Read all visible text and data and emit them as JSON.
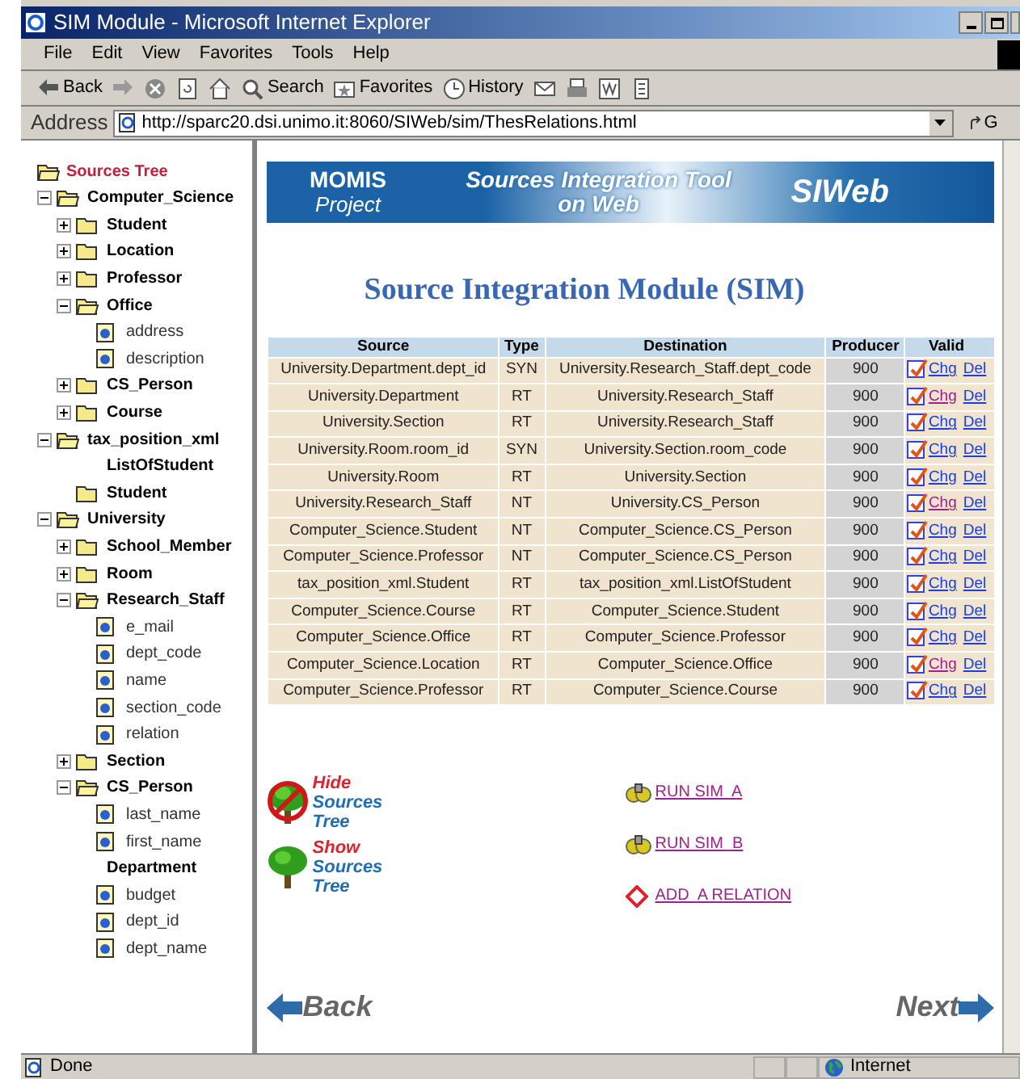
{
  "window": {
    "title": "SIM Module - Microsoft Internet Explorer"
  },
  "menu": [
    "File",
    "Edit",
    "View",
    "Favorites",
    "Tools",
    "Help"
  ],
  "toolbar": [
    {
      "kind": "back",
      "label": "Back"
    },
    {
      "kind": "forward"
    },
    {
      "kind": "stop"
    },
    {
      "kind": "refresh"
    },
    {
      "kind": "home"
    },
    {
      "kind": "search",
      "label": "Search"
    },
    {
      "kind": "favorites",
      "label": "Favorites"
    },
    {
      "kind": "history",
      "label": "History"
    },
    {
      "kind": "mail"
    },
    {
      "kind": "print"
    },
    {
      "kind": "edit"
    },
    {
      "kind": "discuss"
    }
  ],
  "address": {
    "label": "Address",
    "url": "http://sparc20.dsi.unimo.it:8060/SIWeb/sim/ThesRelations.html",
    "go": "G"
  },
  "tree": {
    "title": "Sources Tree",
    "nodes": [
      {
        "label": "Computer_Science",
        "kind": "folder",
        "expanded": true,
        "children": [
          {
            "label": "Student",
            "kind": "folder",
            "expanded": false
          },
          {
            "label": "Location",
            "kind": "folder",
            "expanded": false
          },
          {
            "label": "Professor",
            "kind": "folder",
            "expanded": false
          },
          {
            "label": "Office",
            "kind": "folder",
            "expanded": true,
            "children": [
              {
                "label": "address",
                "kind": "field"
              },
              {
                "label": "description",
                "kind": "field"
              }
            ]
          },
          {
            "label": "CS_Person",
            "kind": "folder",
            "expanded": false
          },
          {
            "label": "Course",
            "kind": "folder",
            "expanded": false
          }
        ]
      },
      {
        "label": "tax_position_xml",
        "kind": "folder",
        "expanded": true,
        "children": [
          {
            "label": "ListOfStudent",
            "kind": "label"
          },
          {
            "label": "Student",
            "kind": "folder"
          }
        ]
      },
      {
        "label": "University",
        "kind": "folder",
        "expanded": true,
        "children": [
          {
            "label": "School_Member",
            "kind": "folder",
            "expanded": false
          },
          {
            "label": "Room",
            "kind": "folder",
            "expanded": false
          },
          {
            "label": "Research_Staff",
            "kind": "folder",
            "expanded": true,
            "children": [
              {
                "label": "e_mail",
                "kind": "field"
              },
              {
                "label": "dept_code",
                "kind": "field"
              },
              {
                "label": "name",
                "kind": "field"
              },
              {
                "label": "section_code",
                "kind": "field"
              },
              {
                "label": "relation",
                "kind": "field"
              }
            ]
          },
          {
            "label": "Section",
            "kind": "folder",
            "expanded": false
          },
          {
            "label": "CS_Person",
            "kind": "folder",
            "expanded": true,
            "children": [
              {
                "label": "last_name",
                "kind": "field"
              },
              {
                "label": "first_name",
                "kind": "field"
              }
            ]
          },
          {
            "label": "Department",
            "kind": "label",
            "children": [
              {
                "label": "budget",
                "kind": "field"
              },
              {
                "label": "dept_id",
                "kind": "field"
              },
              {
                "label": "dept_name",
                "kind": "field"
              }
            ]
          }
        ]
      }
    ]
  },
  "banner": {
    "project_title": "MOMIS",
    "project_subtitle": "Project",
    "tool_title": "Sources Integration Tool",
    "tool_subtitle": "on Web",
    "product": "SIWeb"
  },
  "heading": "Source Integration Module (SIM)",
  "table": {
    "columns": [
      "Source",
      "Type",
      "Destination",
      "Producer",
      "Valid"
    ],
    "rows": [
      {
        "source": "University.Department.dept_id",
        "type": "SYN",
        "destination": "University.Research_Staff.dept_code",
        "producer": "900",
        "valid": true,
        "change": "Chg",
        "change_visited": false,
        "delete": "Del"
      },
      {
        "source": "University.Department",
        "type": "RT",
        "destination": "University.Research_Staff",
        "producer": "900",
        "valid": true,
        "change": "Chg",
        "change_visited": true,
        "delete": "Del"
      },
      {
        "source": "University.Section",
        "type": "RT",
        "destination": "University.Research_Staff",
        "producer": "900",
        "valid": true,
        "change": "Chg",
        "change_visited": false,
        "delete": "Del"
      },
      {
        "source": "University.Room.room_id",
        "type": "SYN",
        "destination": "University.Section.room_code",
        "producer": "900",
        "valid": true,
        "change": "Chg",
        "change_visited": false,
        "delete": "Del"
      },
      {
        "source": "University.Room",
        "type": "RT",
        "destination": "University.Section",
        "producer": "900",
        "valid": true,
        "change": "Chg",
        "change_visited": false,
        "delete": "Del"
      },
      {
        "source": "University.Research_Staff",
        "type": "NT",
        "destination": "University.CS_Person",
        "producer": "900",
        "valid": true,
        "change": "Chg",
        "change_visited": true,
        "delete": "Del"
      },
      {
        "source": "Computer_Science.Student",
        "type": "NT",
        "destination": "Computer_Science.CS_Person",
        "producer": "900",
        "valid": true,
        "change": "Chg",
        "change_visited": false,
        "delete": "Del"
      },
      {
        "source": "Computer_Science.Professor",
        "type": "NT",
        "destination": "Computer_Science.CS_Person",
        "producer": "900",
        "valid": true,
        "change": "Chg",
        "change_visited": false,
        "delete": "Del"
      },
      {
        "source": "tax_position_xml.Student",
        "type": "RT",
        "destination": "tax_position_xml.ListOfStudent",
        "producer": "900",
        "valid": true,
        "change": "Chg",
        "change_visited": false,
        "delete": "Del"
      },
      {
        "source": "Computer_Science.Course",
        "type": "RT",
        "destination": "Computer_Science.Student",
        "producer": "900",
        "valid": true,
        "change": "Chg",
        "change_visited": false,
        "delete": "Del"
      },
      {
        "source": "Computer_Science.Office",
        "type": "RT",
        "destination": "Computer_Science.Professor",
        "producer": "900",
        "valid": true,
        "change": "Chg",
        "change_visited": false,
        "delete": "Del"
      },
      {
        "source": "Computer_Science.Location",
        "type": "RT",
        "destination": "Computer_Science.Office",
        "producer": "900",
        "valid": true,
        "change": "Chg",
        "change_visited": true,
        "delete": "Del"
      },
      {
        "source": "Computer_Science.Professor",
        "type": "RT",
        "destination": "Computer_Science.Course",
        "producer": "900",
        "valid": true,
        "change": "Chg",
        "change_visited": false,
        "delete": "Del"
      }
    ]
  },
  "tree_actions": [
    {
      "kind": "hide",
      "verb": "Hide",
      "words": [
        "Sources",
        "Tree"
      ]
    },
    {
      "kind": "show",
      "verb": "Show",
      "words": [
        "Sources",
        "Tree"
      ]
    }
  ],
  "actions": [
    {
      "kind": "run",
      "label": "RUN SIM  A"
    },
    {
      "kind": "run",
      "label": "RUN SIM  B"
    },
    {
      "kind": "add",
      "label": "ADD  A RELATION"
    }
  ],
  "nav": {
    "back": "Back",
    "next": "Next"
  },
  "status_bar": {
    "text": "Done",
    "zone": "Internet"
  }
}
